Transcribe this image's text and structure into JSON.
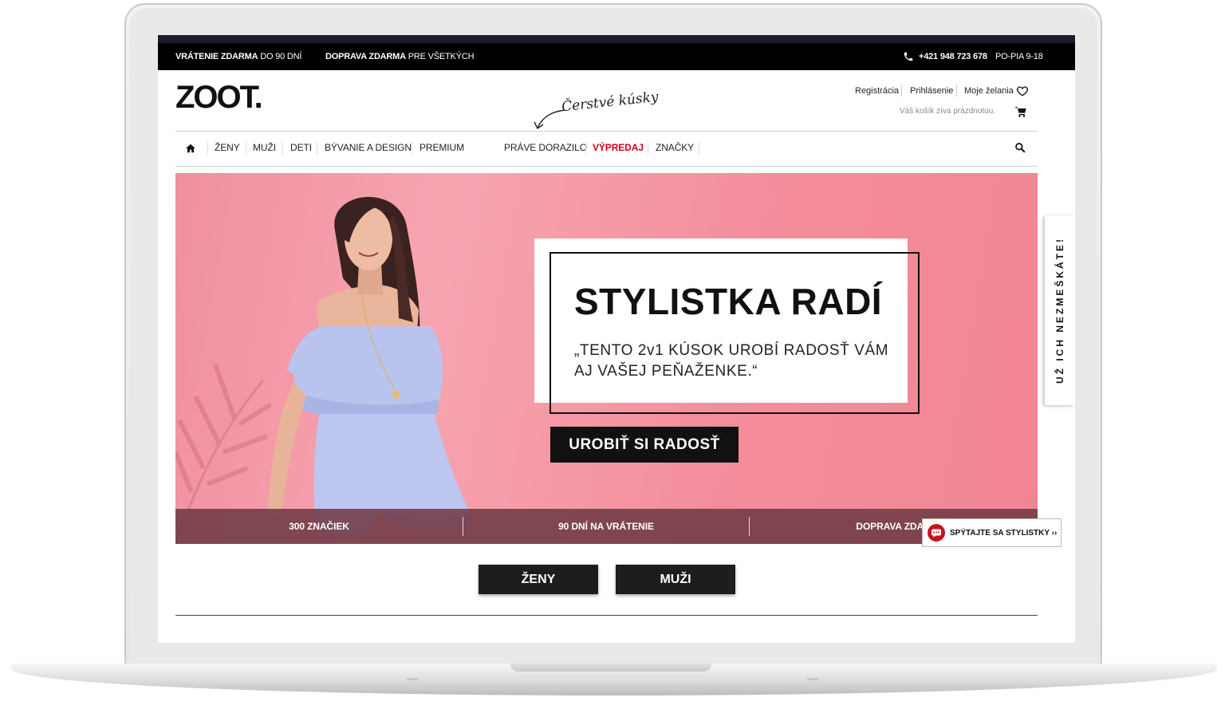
{
  "topbar": {
    "returns_bold": "VRÁTENIE ZDARMA",
    "returns_rest": " DO 90 DNÍ",
    "shipping_bold": "DOPRAVA ZDARMA",
    "shipping_rest": " PRE VŠETKÝCH",
    "phone": "+421 948 723 678",
    "hours": "PO-PIA 9-18"
  },
  "header": {
    "logo": "ZOOT.",
    "register": "Registrácia",
    "login": "Prihlásenie",
    "wishlist": "Moje želania",
    "cart_status": "Váš košík zíva prázdnotou.",
    "fresh_note": "Čerstvé kúsky"
  },
  "nav": {
    "items": [
      "ŽENY",
      "MUŽI",
      "DETI",
      "BÝVANIE A DESIGN",
      "PREMIUM"
    ],
    "secondary": [
      "PRÁVE DORAZILO",
      "VÝPREDAJ",
      "ZNAČKY"
    ]
  },
  "hero": {
    "title": "STYLISTKA RADÍ",
    "subtitle": "„TENTO 2v1 KÚSOK UROBÍ RADOSŤ VÁM AJ VAŠEJ PEŇAŽENKE.“",
    "cta": "UROBIŤ SI RADOSŤ",
    "benefits": [
      "300 ZNAČIEK",
      "90 DNÍ NA VRÁTENIE",
      "DOPRAVA ZDAR"
    ]
  },
  "side_tab": {
    "label": "UŽ ICH NEZMEŠKÁTE!"
  },
  "chat": {
    "label": "SPÝTAJTE SA STYLISTKY ››"
  },
  "gender_buttons": {
    "women": "ŽENY",
    "men": "MUŽI"
  },
  "colors": {
    "sale_red": "#d0021b",
    "hero_pink": "#f49aa8",
    "dark": "#111111",
    "benefits_bar": "#703a46"
  },
  "icons": [
    "phone-icon",
    "heart-icon",
    "cart-icon",
    "home-icon",
    "search-icon",
    "chat-bubble-icon"
  ]
}
